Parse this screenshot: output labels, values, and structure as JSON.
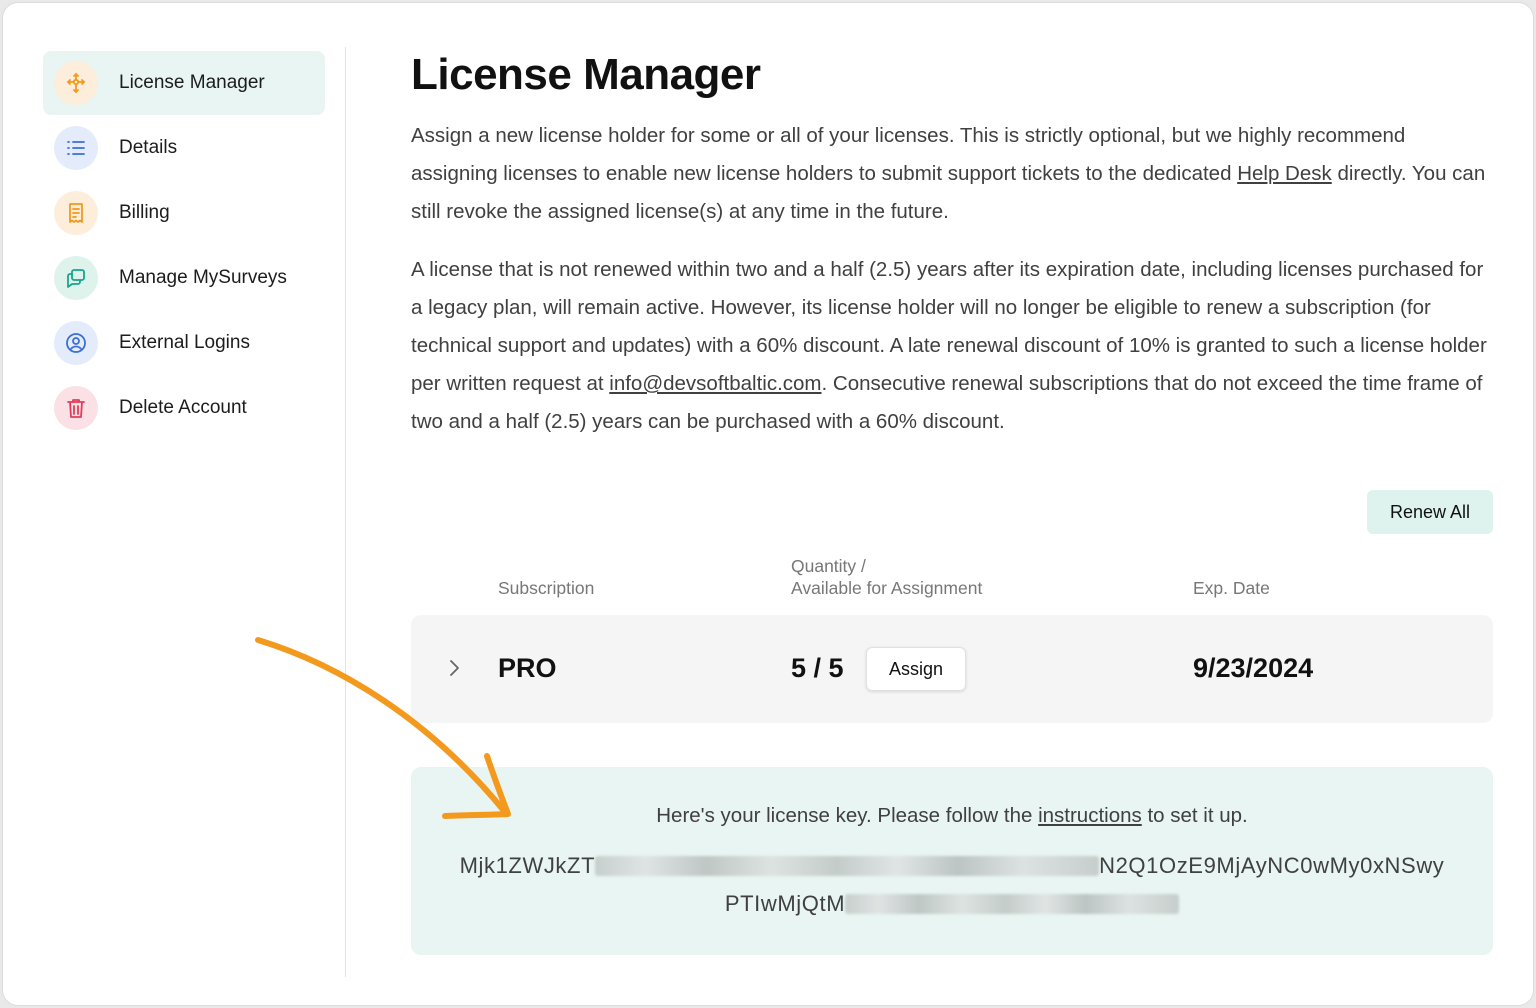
{
  "sidebar": {
    "items": [
      {
        "label": "License Manager",
        "icon": "license-icon",
        "active": true,
        "color": "#f39a1e",
        "bg": "#fdeedb"
      },
      {
        "label": "Details",
        "icon": "list-icon",
        "active": false,
        "color": "#3b6fd8",
        "bg": "#e4ecfb"
      },
      {
        "label": "Billing",
        "icon": "receipt-icon",
        "active": false,
        "color": "#ef9a1f",
        "bg": "#fdeedb"
      },
      {
        "label": "Manage MySurveys",
        "icon": "chat-icon",
        "active": false,
        "color": "#1aa58a",
        "bg": "#ddf3ec"
      },
      {
        "label": "External Logins",
        "icon": "user-circle-icon",
        "active": false,
        "color": "#3b6fd8",
        "bg": "#e4ecfb"
      },
      {
        "label": "Delete Account",
        "icon": "trash-icon",
        "active": false,
        "color": "#e23b5a",
        "bg": "#fbe1e6"
      }
    ]
  },
  "main": {
    "title": "License Manager",
    "para1": {
      "before": "Assign a new license holder for some or all of your licenses. This is strictly optional, but we highly recommend assigning licenses to enable new license holders to submit support tickets to the dedicated ",
      "link": "Help Desk",
      "after": " directly. You can still revoke the assigned license(s) at any time in the future."
    },
    "para2": {
      "before": "A license that is not renewed within two and a half (2.5) years after its expiration date, including licenses purchased for a legacy plan, will remain active. However, its license holder will no longer be eligible to renew a subscription (for technical support and updates) with a 60% discount. A late renewal discount of 10% is granted to such a license holder per written request at ",
      "link": "info@devsoftbaltic.com",
      "after": ". Consecutive renewal subscriptions that do not exceed the time frame of two and a half (2.5) years can be purchased with a 60% discount."
    },
    "renew_all_label": "Renew All",
    "table": {
      "col_subscription": "Subscription",
      "col_quantity_line1": "Quantity /",
      "col_quantity_line2": "Available for Assignment",
      "col_exp": "Exp. Date",
      "row": {
        "plan": "PRO",
        "quantity": "5 / 5",
        "assign_label": "Assign",
        "exp_date": "9/23/2024"
      }
    },
    "license_key": {
      "message_before": "Here's your license key. Please follow the ",
      "message_link": "instructions",
      "message_after": " to set it up.",
      "line1_start": "Mjk1ZWJkZT",
      "line1_end": "N2Q1OzE9MjAyNC0wMy0xNSwy",
      "line2_start": "PTIwMjQtM"
    }
  },
  "annotation_arrow_color": "#f39a1e"
}
